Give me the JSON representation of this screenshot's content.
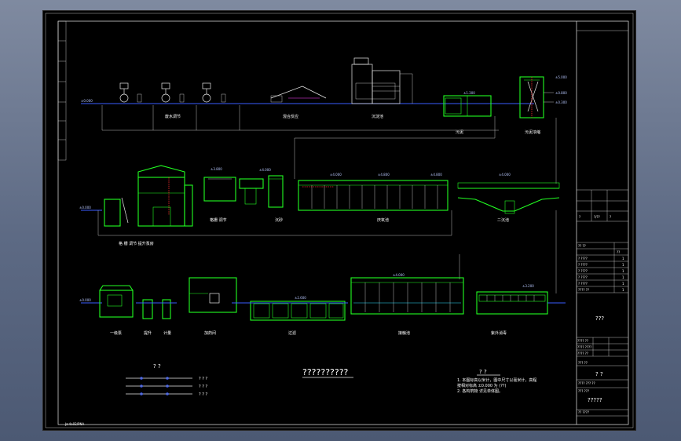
{
  "drawing": {
    "row1_labels": [
      "废水调节",
      "混合反应",
      "沉淀池",
      "污泥",
      "污泥浓缩"
    ],
    "row2_labels": [
      "格栅 调节",
      "沉砂",
      "厌氧池",
      "二沉池"
    ],
    "row2_bottom_label": "格 栅 调节 提升泵房",
    "row3_labels": [
      "一级泵",
      "提升",
      "计量",
      "加药间",
      "过滤",
      "接触池",
      "紫外消毒"
    ],
    "main_title": "??????????",
    "legend": {
      "title": "? ?",
      "rows": [
        "? ? ?",
        "? ? ?",
        "? ? ?"
      ]
    },
    "notes": {
      "title": "? ?",
      "lines": [
        "1. 本图标高以米计，图中尺寸以毫米计，高程",
        "   按相对标高 ±0.000 为 (??)",
        "2. 各构筑物 详见单体图。"
      ]
    },
    "bottom_left_text": "Jz:4a02/PNA"
  },
  "title_block": {
    "revision_cols": [
      "?",
      "?/??",
      "?"
    ],
    "parts_header": [
      "?? ??",
      "??"
    ],
    "parts": [
      {
        "name": "? ????",
        "qty": "1"
      },
      {
        "name": "? ????",
        "qty": "1"
      },
      {
        "name": "? ????",
        "qty": "1"
      },
      {
        "name": "? ????",
        "qty": "1"
      },
      {
        "name": "? ????",
        "qty": "1"
      },
      {
        "name": "???? ??",
        "qty": "1"
      }
    ],
    "company": "???",
    "sign_rows": [
      "???? ??",
      "???? ????",
      "???? ??"
    ],
    "scale_label": "??? ??",
    "drawing_title": "? ?",
    "meta_row": "???? ??? ??",
    "sheet_label": "??? ???",
    "drawing_no": "?????",
    "bottom_row": "?? ????"
  },
  "colors": {
    "structure": "#22ff22",
    "pipe": "#3a5cff",
    "annotation": "#ffffff",
    "sheet_background": "#000000"
  }
}
